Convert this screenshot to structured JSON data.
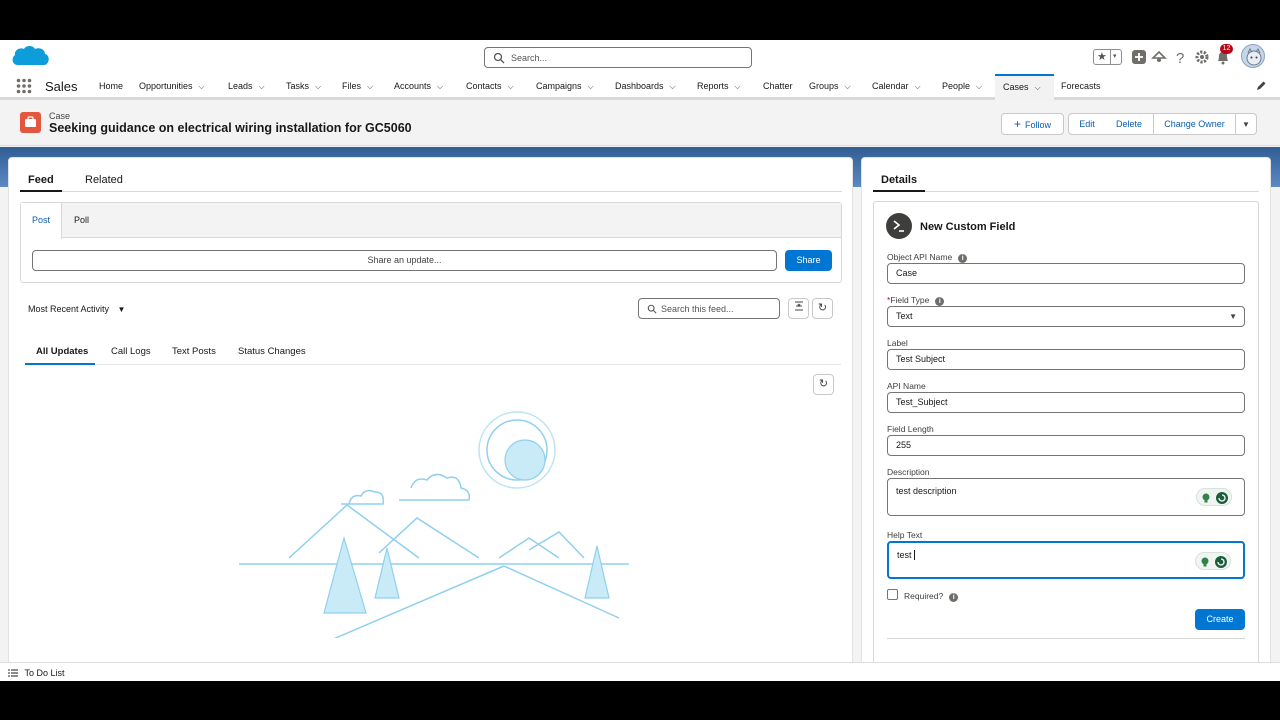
{
  "header": {
    "search_placeholder": "Search...",
    "notification_count": "12"
  },
  "nav": {
    "app_name": "Sales",
    "items": [
      {
        "label": "Home",
        "has_menu": false
      },
      {
        "label": "Opportunities",
        "has_menu": true
      },
      {
        "label": "Leads",
        "has_menu": true
      },
      {
        "label": "Tasks",
        "has_menu": true
      },
      {
        "label": "Files",
        "has_menu": true
      },
      {
        "label": "Accounts",
        "has_menu": true
      },
      {
        "label": "Contacts",
        "has_menu": true
      },
      {
        "label": "Campaigns",
        "has_menu": true
      },
      {
        "label": "Dashboards",
        "has_menu": true
      },
      {
        "label": "Reports",
        "has_menu": true
      },
      {
        "label": "Chatter",
        "has_menu": false
      },
      {
        "label": "Groups",
        "has_menu": true
      },
      {
        "label": "Calendar",
        "has_menu": true
      },
      {
        "label": "People",
        "has_menu": true
      },
      {
        "label": "Cases",
        "has_menu": true,
        "active": true
      },
      {
        "label": "Forecasts",
        "has_menu": false
      }
    ]
  },
  "record": {
    "object_label": "Case",
    "title": "Seeking guidance on electrical wiring installation for GC5060",
    "actions": {
      "follow": "Follow",
      "edit": "Edit",
      "delete": "Delete",
      "change_owner": "Change Owner"
    }
  },
  "left_panel": {
    "tabs": [
      "Feed",
      "Related"
    ],
    "publisher": {
      "tabs": [
        "Post",
        "Poll"
      ],
      "input_placeholder": "Share an update...",
      "share_label": "Share"
    },
    "sort_label": "Most Recent Activity",
    "feed_search_placeholder": "Search this feed...",
    "filter_tabs": [
      "All Updates",
      "Call Logs",
      "Text Posts",
      "Status Changes"
    ]
  },
  "right_panel": {
    "tab": "Details",
    "form": {
      "title": "New Custom Field",
      "object_api_name_label": "Object API Name",
      "object_api_name_value": "Case",
      "field_type_required_mark": "*",
      "field_type_label": "Field Type",
      "field_type_value": "Text",
      "label_label": "Label",
      "label_value": "Test Subject",
      "api_name_label": "API Name",
      "api_name_value": "Test_Subject",
      "field_length_label": "Field Length",
      "field_length_value": "255",
      "description_label": "Description",
      "description_value": "test description",
      "help_text_label": "Help Text",
      "help_text_value": "test",
      "required_label": "Required?",
      "required_checked": false,
      "create_label": "Create"
    }
  },
  "utility_bar": {
    "todo_label": "To Do List"
  },
  "colors": {
    "brand_blue": "#0176d3",
    "case_icon": "#e3573e",
    "illustration": "#8fd0ee"
  }
}
